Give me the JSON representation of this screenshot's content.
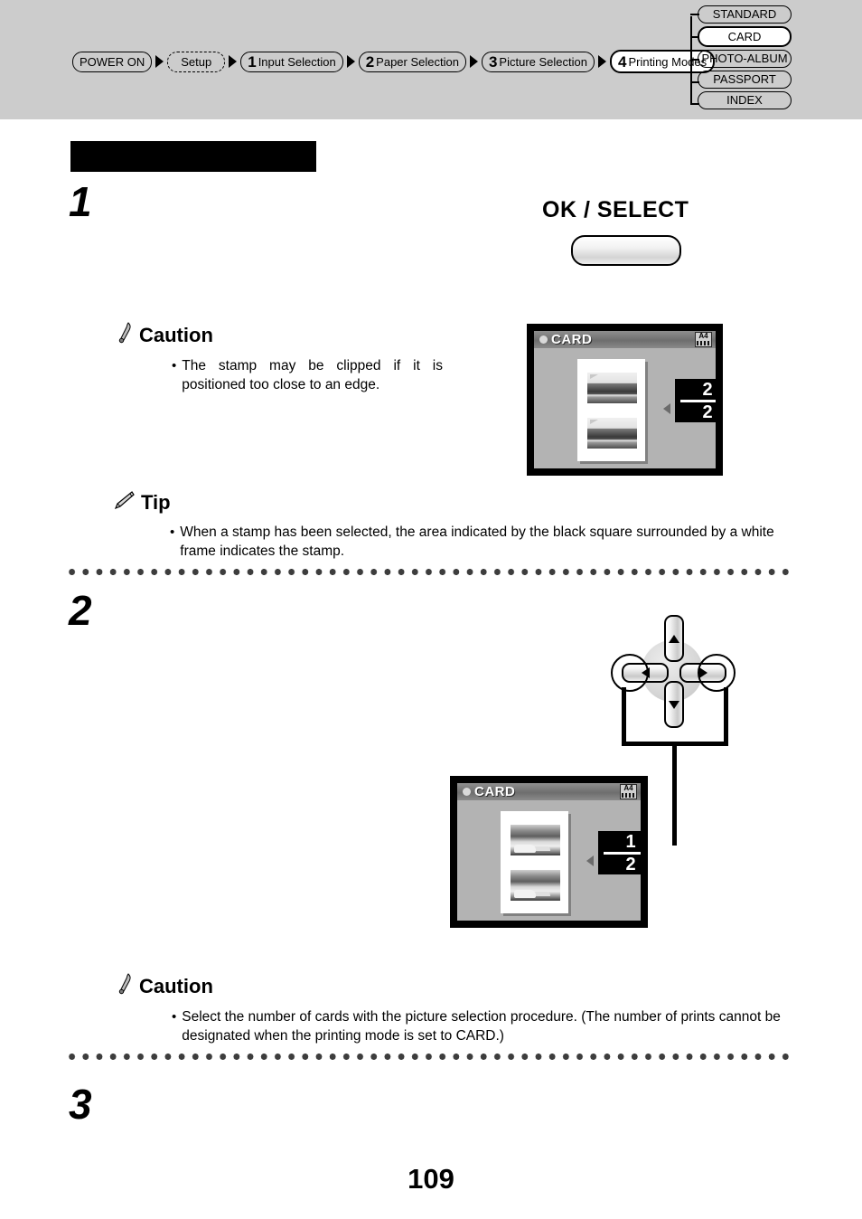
{
  "header": {
    "breadcrumb": [
      {
        "num": "",
        "label": "POWER ON",
        "style": "solid",
        "active": false
      },
      {
        "num": "",
        "label": "Setup",
        "style": "dashed",
        "active": false
      },
      {
        "num": "1",
        "label": "Input Selection",
        "style": "solid",
        "active": false
      },
      {
        "num": "2",
        "label": "Paper Selection",
        "style": "solid",
        "active": false
      },
      {
        "num": "3",
        "label": "Picture Selection",
        "style": "solid",
        "active": false
      },
      {
        "num": "4",
        "label": "Printing Modes",
        "style": "solid",
        "active": true
      }
    ],
    "modes": [
      {
        "label": "STANDARD",
        "selected": false
      },
      {
        "label": "CARD",
        "selected": true
      },
      {
        "label": "PHOTO-ALBUM",
        "selected": false
      },
      {
        "label": "PASSPORT",
        "selected": false
      },
      {
        "label": "INDEX",
        "selected": false
      }
    ]
  },
  "steps": {
    "one": "1",
    "two": "2",
    "three": "3"
  },
  "control": {
    "ok_select_label": "OK / SELECT"
  },
  "caution_1": {
    "heading": "Caution",
    "bullet": "•",
    "text": "The stamp may be clipped if it is positioned too close to an edge."
  },
  "tip_1": {
    "heading": "Tip",
    "bullet": "•",
    "text": "When a stamp has been selected, the area indicated by the black square surrounded by a white frame indicates the stamp."
  },
  "caution_2": {
    "heading": "Caution",
    "bullet": "•",
    "text": "Select the number of cards with the picture selection procedure. (The number of prints cannot be designated when the printing mode is set to CARD.)"
  },
  "lcd_1": {
    "title": "CARD",
    "paper_icon": "A4",
    "counter_top": "2",
    "counter_bottom": "2",
    "photo_style": "landscape"
  },
  "lcd_2": {
    "title": "CARD",
    "paper_icon": "A4",
    "counter_top": "1",
    "counter_bottom": "2",
    "photo_style": "street"
  },
  "footer": {
    "page_number": "109"
  },
  "colors": {
    "header_background": "#cccccc",
    "lcd_bezel": "#000000",
    "lcd_screen": "#b3b3b3",
    "accent_black": "#000000"
  }
}
